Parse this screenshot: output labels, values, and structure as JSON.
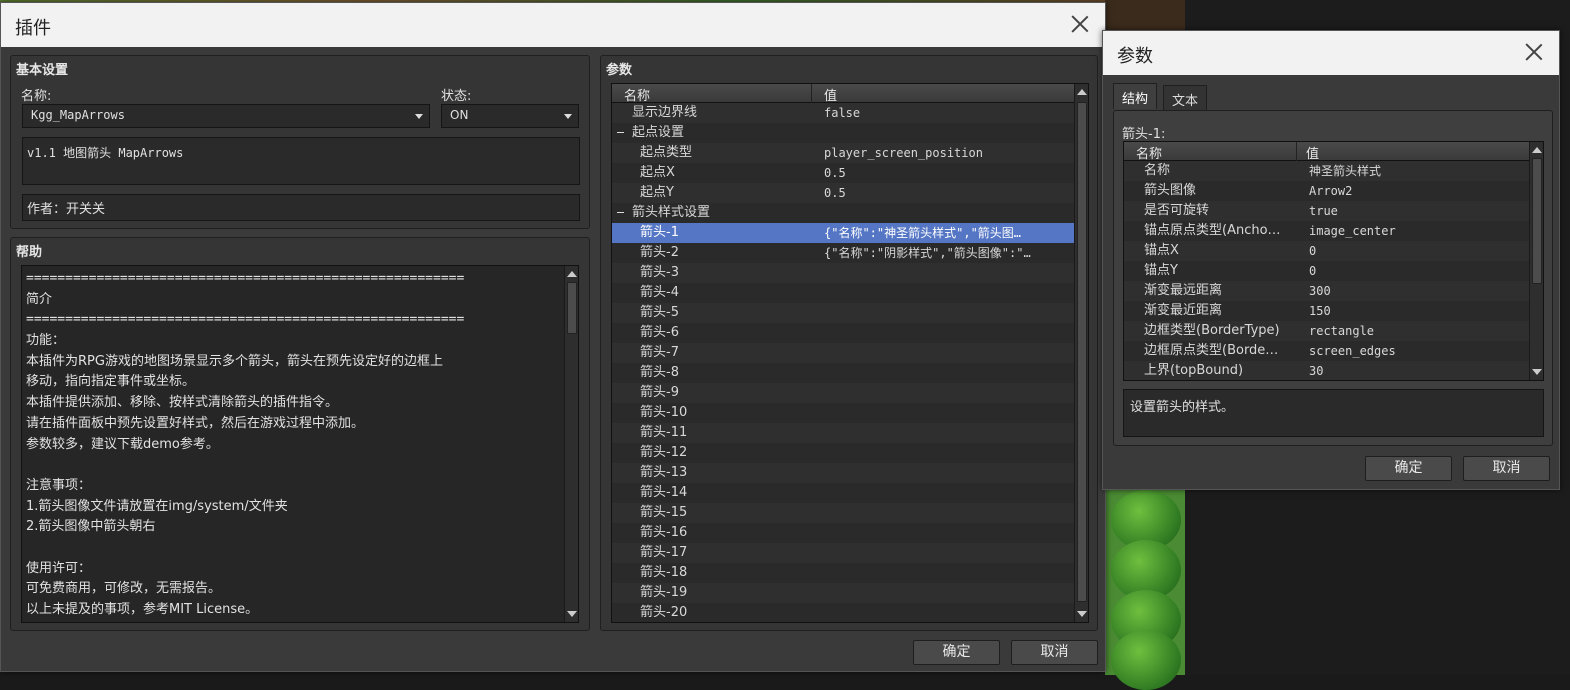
{
  "plugin_window": {
    "title": "插件",
    "basic_group": "基本设置",
    "name_label": "名称:",
    "name_value": "Kgg_MapArrows",
    "status_label": "状态:",
    "status_value": "ON",
    "description": "v1.1 地图箭头 MapArrows",
    "author": "作者：开关关",
    "help_group": "帮助",
    "help_lines": [
      "========================================================",
      "简介",
      "========================================================",
      "功能：",
      "本插件为RPG游戏的地图场景显示多个箭头，箭头在预先设定好的边框上",
      "移动，指向指定事件或坐标。",
      "本插件提供添加、移除、按样式清除箭头的插件指令。",
      "请在插件面板中预先设置好样式，然后在游戏过程中添加。",
      "参数较多，建议下载demo参考。",
      "",
      "注意事项：",
      "1.箭头图像文件请放置在img/system/文件夹",
      "2.箭头图像中箭头朝右",
      "",
      "使用许可：",
      "可免费商用，可修改，无需报告。",
      "以上未提及的事项，参考MIT License。"
    ],
    "params_group": "参数",
    "params_header_name": "名称",
    "params_header_value": "值",
    "params_rows": [
      {
        "name": "显示边界线",
        "value": "false",
        "indent": 1
      },
      {
        "name": "起点设置",
        "value": "",
        "indent": 0,
        "expander": true
      },
      {
        "name": "起点类型",
        "value": "player_screen_position",
        "indent": 2
      },
      {
        "name": "起点X",
        "value": "0.5",
        "indent": 2
      },
      {
        "name": "起点Y",
        "value": "0.5",
        "indent": 2
      },
      {
        "name": "箭头样式设置",
        "value": "",
        "indent": 0,
        "expander": true
      },
      {
        "name": "箭头-1",
        "value": "{\"名称\":\"神圣箭头样式\",\"箭头图…",
        "indent": 2,
        "selected": true
      },
      {
        "name": "箭头-2",
        "value": "{\"名称\":\"阴影样式\",\"箭头图像\":\"…",
        "indent": 2
      },
      {
        "name": "箭头-3",
        "value": "",
        "indent": 2
      },
      {
        "name": "箭头-4",
        "value": "",
        "indent": 2
      },
      {
        "name": "箭头-5",
        "value": "",
        "indent": 2
      },
      {
        "name": "箭头-6",
        "value": "",
        "indent": 2
      },
      {
        "name": "箭头-7",
        "value": "",
        "indent": 2
      },
      {
        "name": "箭头-8",
        "value": "",
        "indent": 2
      },
      {
        "name": "箭头-9",
        "value": "",
        "indent": 2
      },
      {
        "name": "箭头-10",
        "value": "",
        "indent": 2
      },
      {
        "name": "箭头-11",
        "value": "",
        "indent": 2
      },
      {
        "name": "箭头-12",
        "value": "",
        "indent": 2
      },
      {
        "name": "箭头-13",
        "value": "",
        "indent": 2
      },
      {
        "name": "箭头-14",
        "value": "",
        "indent": 2
      },
      {
        "name": "箭头-15",
        "value": "",
        "indent": 2
      },
      {
        "name": "箭头-16",
        "value": "",
        "indent": 2
      },
      {
        "name": "箭头-17",
        "value": "",
        "indent": 2
      },
      {
        "name": "箭头-18",
        "value": "",
        "indent": 2
      },
      {
        "name": "箭头-19",
        "value": "",
        "indent": 2
      },
      {
        "name": "箭头-20",
        "value": "",
        "indent": 2
      }
    ],
    "ok_label": "确定",
    "cancel_label": "取消"
  },
  "param_window": {
    "title": "参数",
    "tabs": [
      "结构",
      "文本"
    ],
    "section_label": "箭头-1:",
    "header_name": "名称",
    "header_value": "值",
    "rows": [
      {
        "name": "名称",
        "value": "神圣箭头样式"
      },
      {
        "name": "箭头图像",
        "value": "Arrow2"
      },
      {
        "name": "是否可旋转",
        "value": "true"
      },
      {
        "name": "锚点原点类型(Ancho…",
        "value": "image_center"
      },
      {
        "name": "锚点X",
        "value": "0"
      },
      {
        "name": "锚点Y",
        "value": "0"
      },
      {
        "name": "渐变最远距离",
        "value": "300"
      },
      {
        "name": "渐变最近距离",
        "value": "150"
      },
      {
        "name": "边框类型(BorderType)",
        "value": "rectangle"
      },
      {
        "name": "边框原点类型(Borde…",
        "value": "screen_edges"
      },
      {
        "name": "上界(topBound)",
        "value": "30"
      }
    ],
    "description": "设置箭头的样式。",
    "ok_label": "确定",
    "cancel_label": "取消"
  }
}
